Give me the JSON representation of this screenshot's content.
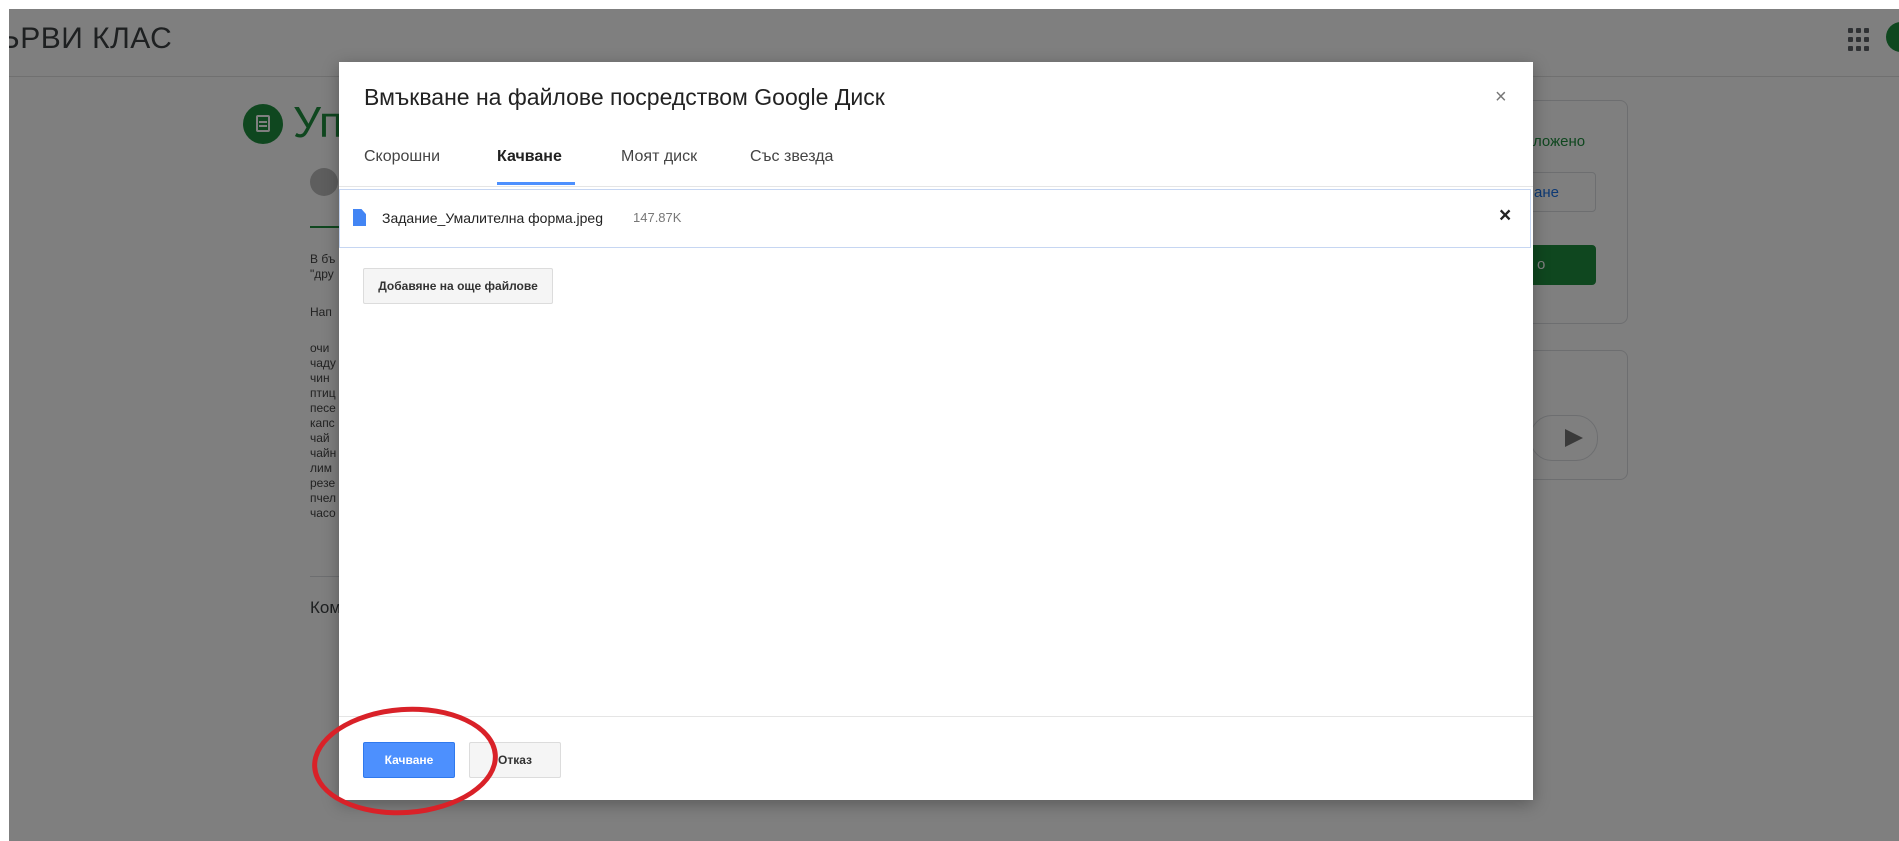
{
  "background_page": {
    "class_title": "ЬРВИ КЛАС",
    "assignment_title_fragment": "Уп",
    "body_snippets": [
      "В бъ",
      "\"дру",
      "Нап",
      "очи",
      "чаду",
      "чин",
      "птиц",
      "песе",
      "капс",
      "чай",
      "чайн",
      "лим",
      "резе",
      "пчел",
      "часо"
    ],
    "comments_label_fragment": "Ком",
    "side_status_fragment": "ложено",
    "side_add_fragment": "ане",
    "side_submit_fragment": "о",
    "colors": {
      "accent_green": "#1e8e3e"
    }
  },
  "dialog": {
    "title": "Вмъкване на файлове посредством Google Диск",
    "close_glyph": "×",
    "tabs": [
      {
        "label": "Скорошни",
        "active": false
      },
      {
        "label": "Качване",
        "active": true
      },
      {
        "label": "Моят диск",
        "active": false
      },
      {
        "label": "Със звезда",
        "active": false
      }
    ],
    "file": {
      "icon": "file-icon",
      "name": "Задание_Умалителна форма.jpeg",
      "size": "147.87K",
      "remove_glyph": "×"
    },
    "add_more_label": "Добавяне на още файлове",
    "upload_label": "Качване",
    "cancel_label": "Отказ",
    "colors": {
      "primary_button": "#4d90fe",
      "highlight_ring": "#d92128"
    }
  }
}
